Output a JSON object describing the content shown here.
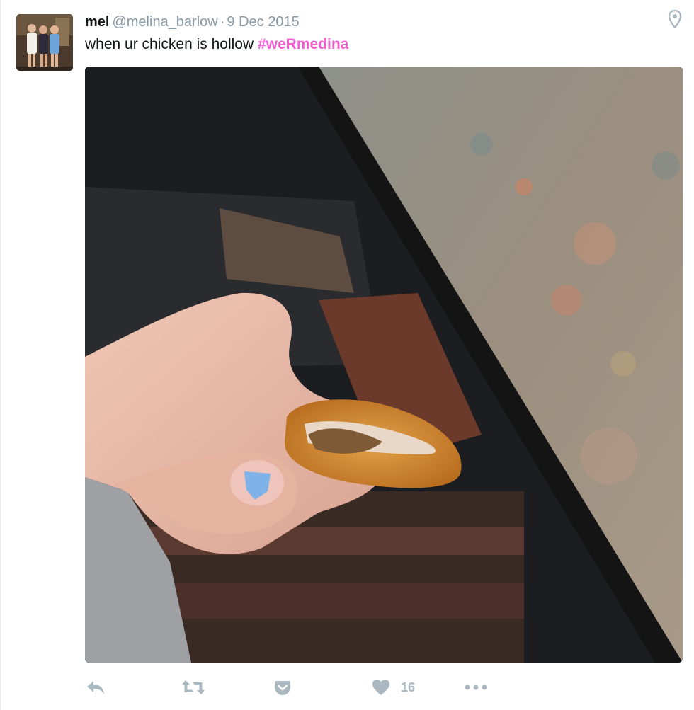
{
  "user": {
    "display_name": "mel",
    "handle": "@melina_barlow",
    "separator": "·",
    "date": "9 Dec 2015"
  },
  "tweet": {
    "text": "when ur chicken is hollow",
    "hashtag": "#weRmedina"
  },
  "media": {
    "icon": "photo-of-hollow-chicken-nugget"
  },
  "actions": {
    "like_count": "16"
  },
  "colors": {
    "hashtag": "#f45dd1",
    "muted": "#8899a6",
    "action_icon": "#aab8c2"
  }
}
